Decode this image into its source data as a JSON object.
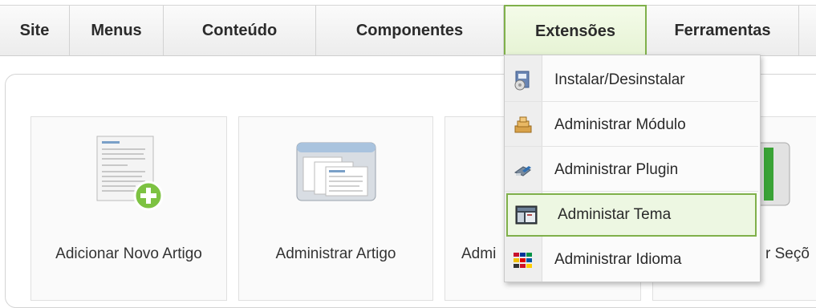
{
  "menubar": {
    "items": [
      {
        "label": "Site"
      },
      {
        "label": "Menus"
      },
      {
        "label": "Conteúdo"
      },
      {
        "label": "Componentes"
      },
      {
        "label": "Extensões"
      },
      {
        "label": "Ferramentas"
      }
    ],
    "active_index": 4,
    "active_color": "#7fb04a"
  },
  "cards": [
    {
      "label": "Adicionar Novo Artigo",
      "icon": "add-article-icon"
    },
    {
      "label": "Administrar Artigo",
      "icon": "manage-articles-icon"
    },
    {
      "label": "Admi",
      "icon": "hidden-icon"
    },
    {
      "label": "r Seçõ",
      "icon": "manage-sections-icon"
    }
  ],
  "dropdown": {
    "items": [
      {
        "label": "Instalar/Desinstalar",
        "icon": "install-icon"
      },
      {
        "label": "Administrar Módulo",
        "icon": "module-icon"
      },
      {
        "label": "Administrar Plugin",
        "icon": "plugin-icon"
      },
      {
        "label": "Administar Tema",
        "icon": "template-icon"
      },
      {
        "label": "Administrar Idioma",
        "icon": "language-icon"
      }
    ],
    "highlighted_index": 3
  }
}
